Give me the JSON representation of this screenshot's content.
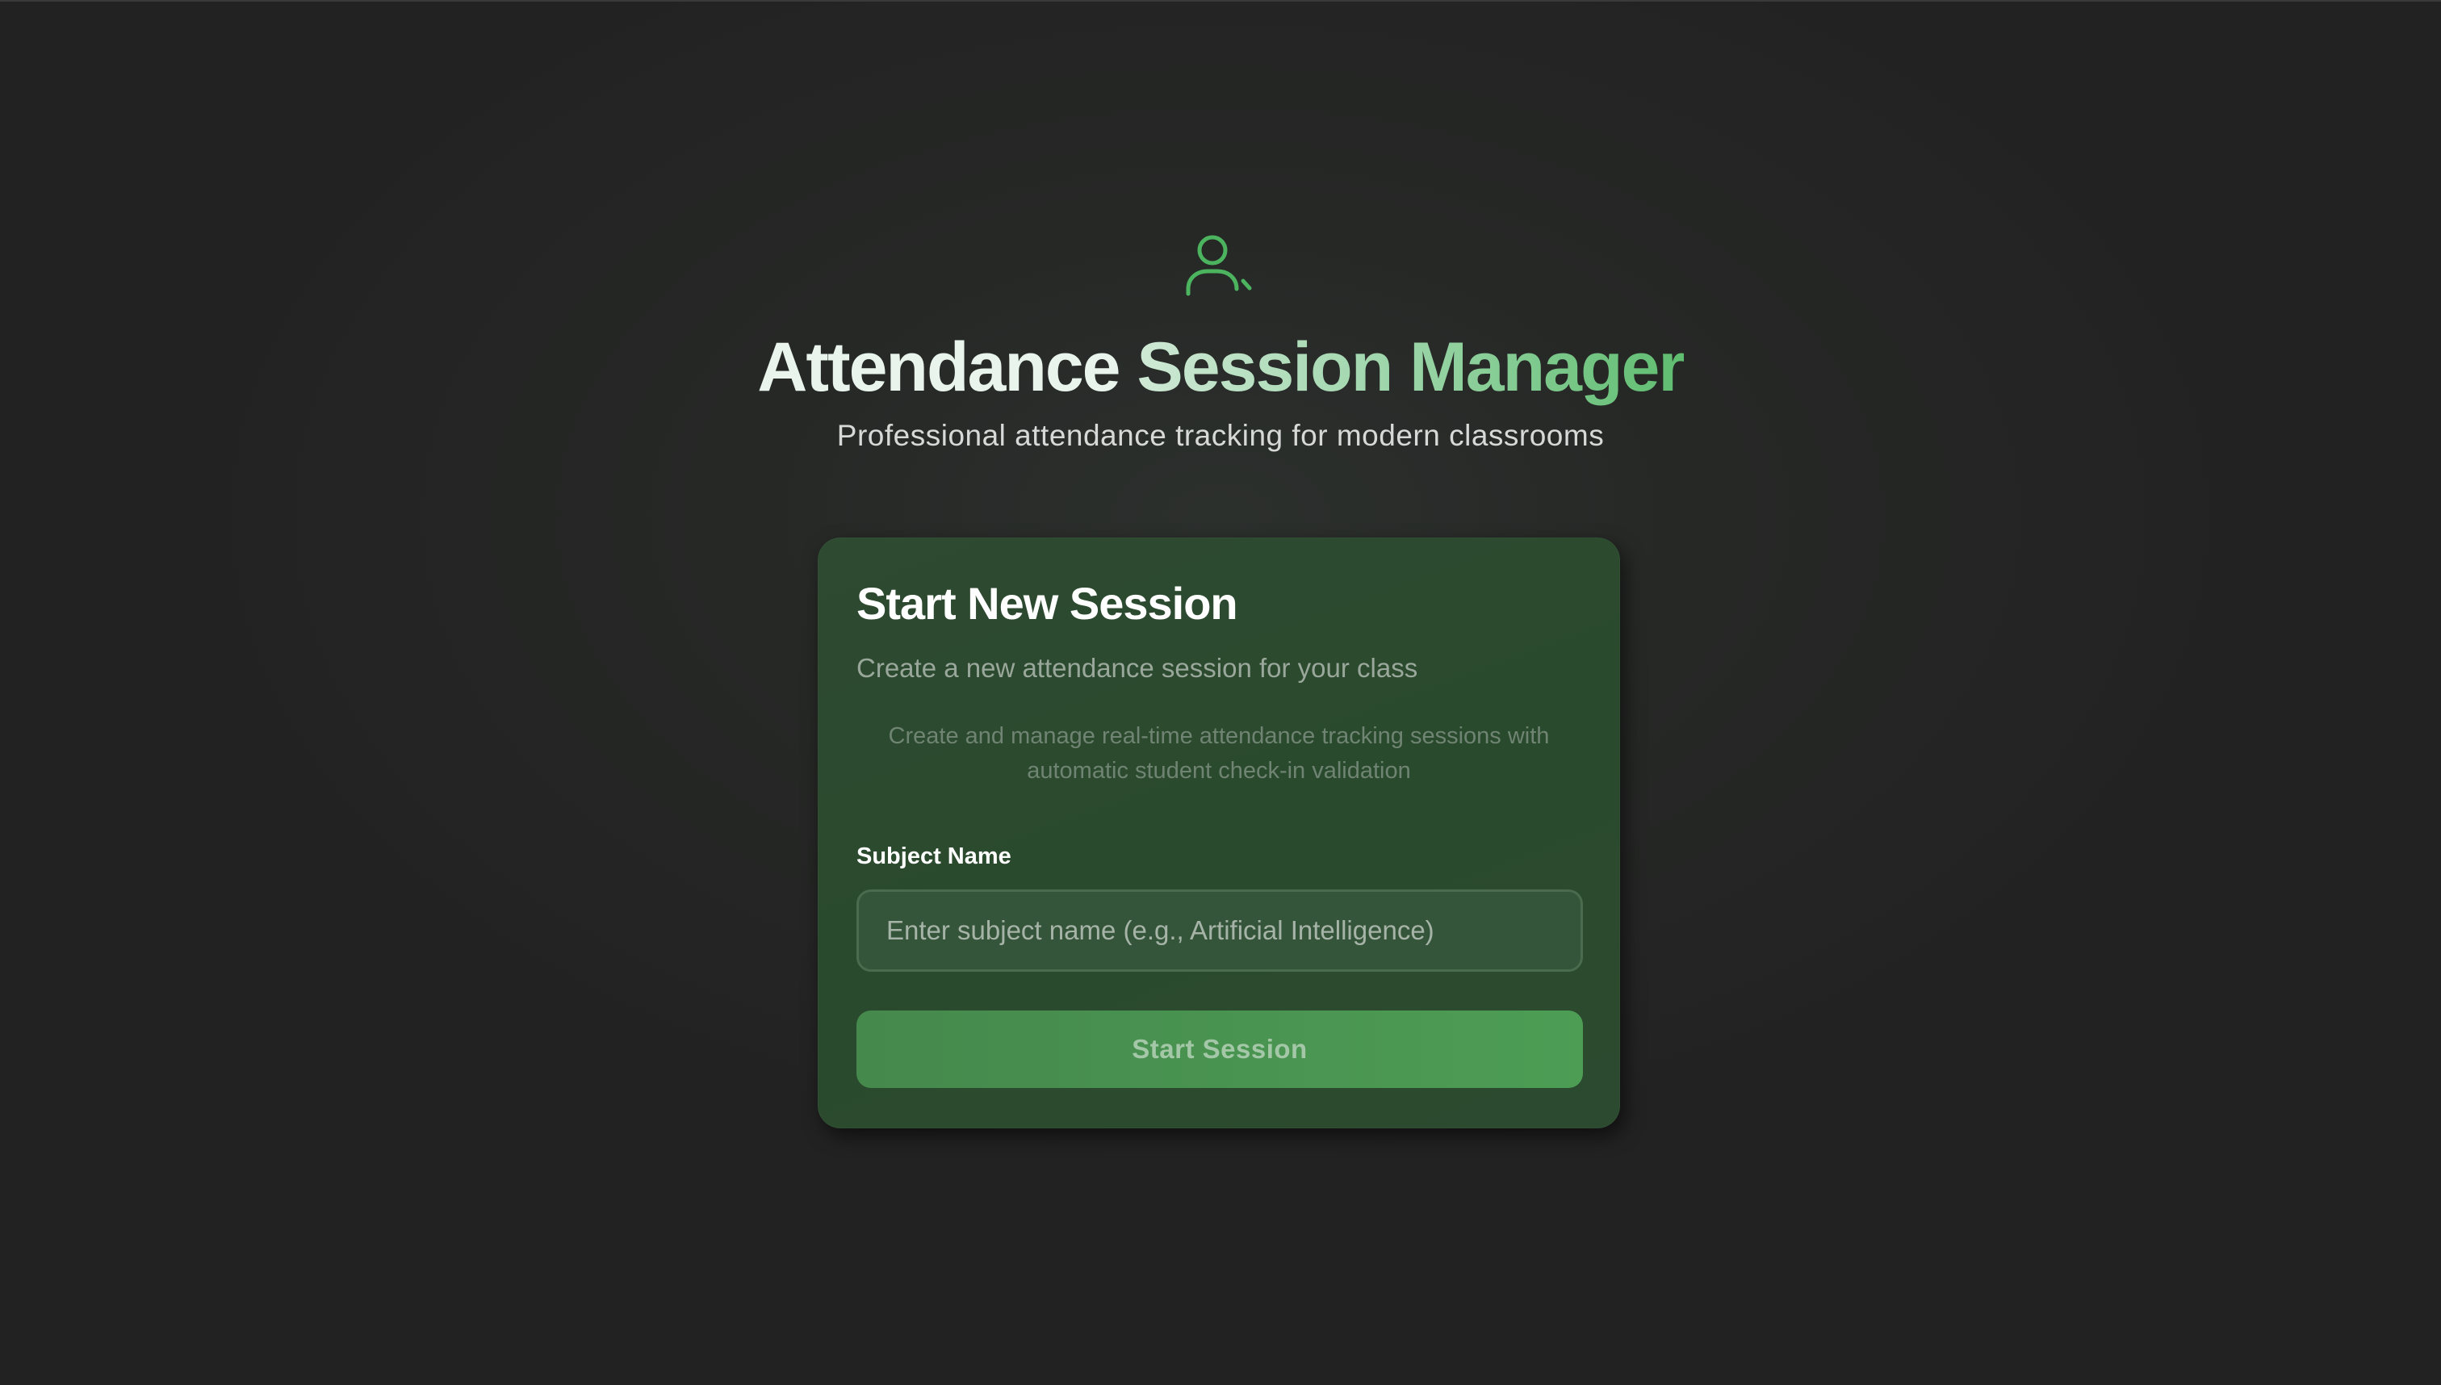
{
  "header": {
    "icon": "user-check-icon",
    "title_part1": "Attendance ",
    "title_part2": "Session Manager",
    "subtitle": "Professional attendance tracking for modern classrooms"
  },
  "card": {
    "title": "Start New Session",
    "description": "Create a new attendance session for your class",
    "info": "Create and manage real-time attendance tracking sessions with automatic student check-in validation",
    "subject_label": "Subject Name",
    "subject_value": "",
    "subject_placeholder": "Enter subject name (e.g., Artificial Intelligence)",
    "start_button_label": "Start Session"
  },
  "colors": {
    "accent": "#5fbd70",
    "card_bg": "#2c4a2f",
    "button_bg": "#4a9552",
    "page_bg": "#262826"
  }
}
